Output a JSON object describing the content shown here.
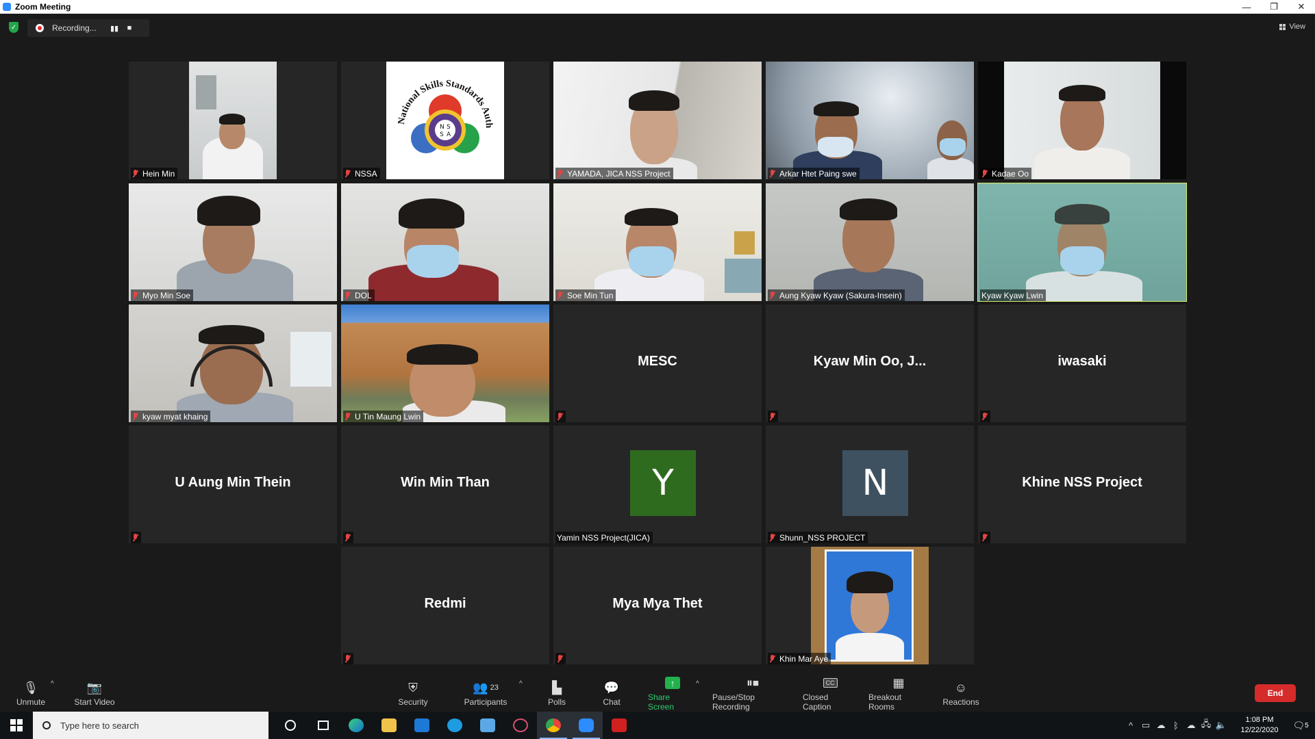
{
  "window": {
    "title": "Zoom Meeting"
  },
  "recording": {
    "status": "Recording...",
    "pause_icon": "pause-icon",
    "stop_icon": "stop-icon"
  },
  "view": {
    "label": "View"
  },
  "participants": [
    {
      "name": "Hein Min",
      "type": "video"
    },
    {
      "name": "NSSA",
      "type": "logo",
      "logo_text": "National Skills Standards Authority",
      "logo_inner": [
        "N",
        "S",
        "S",
        "A"
      ]
    },
    {
      "name": "YAMADA, JICA NSS Project",
      "type": "video"
    },
    {
      "name": "Arkar Htet Paing swe",
      "type": "video"
    },
    {
      "name": "Kadae Oo",
      "type": "video"
    },
    {
      "name": "Myo Min Soe",
      "type": "video"
    },
    {
      "name": "DOL",
      "type": "video"
    },
    {
      "name": "Soe Min Tun",
      "type": "video"
    },
    {
      "name": "Aung Kyaw Kyaw (Sakura-Insein)",
      "type": "video"
    },
    {
      "name": "Kyaw Kyaw Lwin",
      "type": "video",
      "active_speaker": true
    },
    {
      "name": "kyaw myat khaing",
      "type": "video"
    },
    {
      "name": "U Tin Maung Lwin",
      "type": "video"
    },
    {
      "name": "MESC",
      "type": "name"
    },
    {
      "name": "Kyaw Min Oo, J...",
      "type": "name"
    },
    {
      "name": "iwasaki",
      "type": "name"
    },
    {
      "name": "U Aung Min Thein",
      "type": "name"
    },
    {
      "name": "Win Min Than",
      "type": "name"
    },
    {
      "name": "Yamin NSS Project(JICA)",
      "type": "avatar",
      "letter": "Y",
      "color": "#2f6b1f"
    },
    {
      "name": "Shunn_NSS PROJECT",
      "type": "avatar",
      "letter": "N",
      "color": "#3e5160"
    },
    {
      "name": "Khine NSS Project",
      "type": "name"
    },
    {
      "name": "Redmi",
      "type": "name"
    },
    {
      "name": "Mya Mya Thet",
      "type": "name"
    },
    {
      "name": "Khin Mar Aye",
      "type": "photo"
    }
  ],
  "toolbar": {
    "unmute": "Unmute",
    "start_video": "Start Video",
    "security": "Security",
    "participants": "Participants",
    "participant_count": "23",
    "polls": "Polls",
    "chat": "Chat",
    "share_screen": "Share Screen",
    "pause_stop_recording": "Pause/Stop Recording",
    "closed_caption": "Closed Caption",
    "closed_caption_icon_text": "CC",
    "breakout_rooms": "Breakout Rooms",
    "reactions": "Reactions",
    "end": "End"
  },
  "taskbar": {
    "search_placeholder": "Type here to search",
    "time": "1:08 PM",
    "date": "12/22/2020",
    "notification_count": "5",
    "apps": [
      "task-view-icon",
      "edge-icon",
      "file-explorer-icon",
      "mail-icon",
      "browser-icon",
      "onedrive-icon",
      "snipping-icon",
      "chrome-icon",
      "zoom-icon",
      "acrobat-icon"
    ]
  },
  "colors": {
    "active_speaker": "#dcef6a",
    "end": "#d62b2b",
    "share": "#23b14d",
    "mute": "#e34444"
  }
}
